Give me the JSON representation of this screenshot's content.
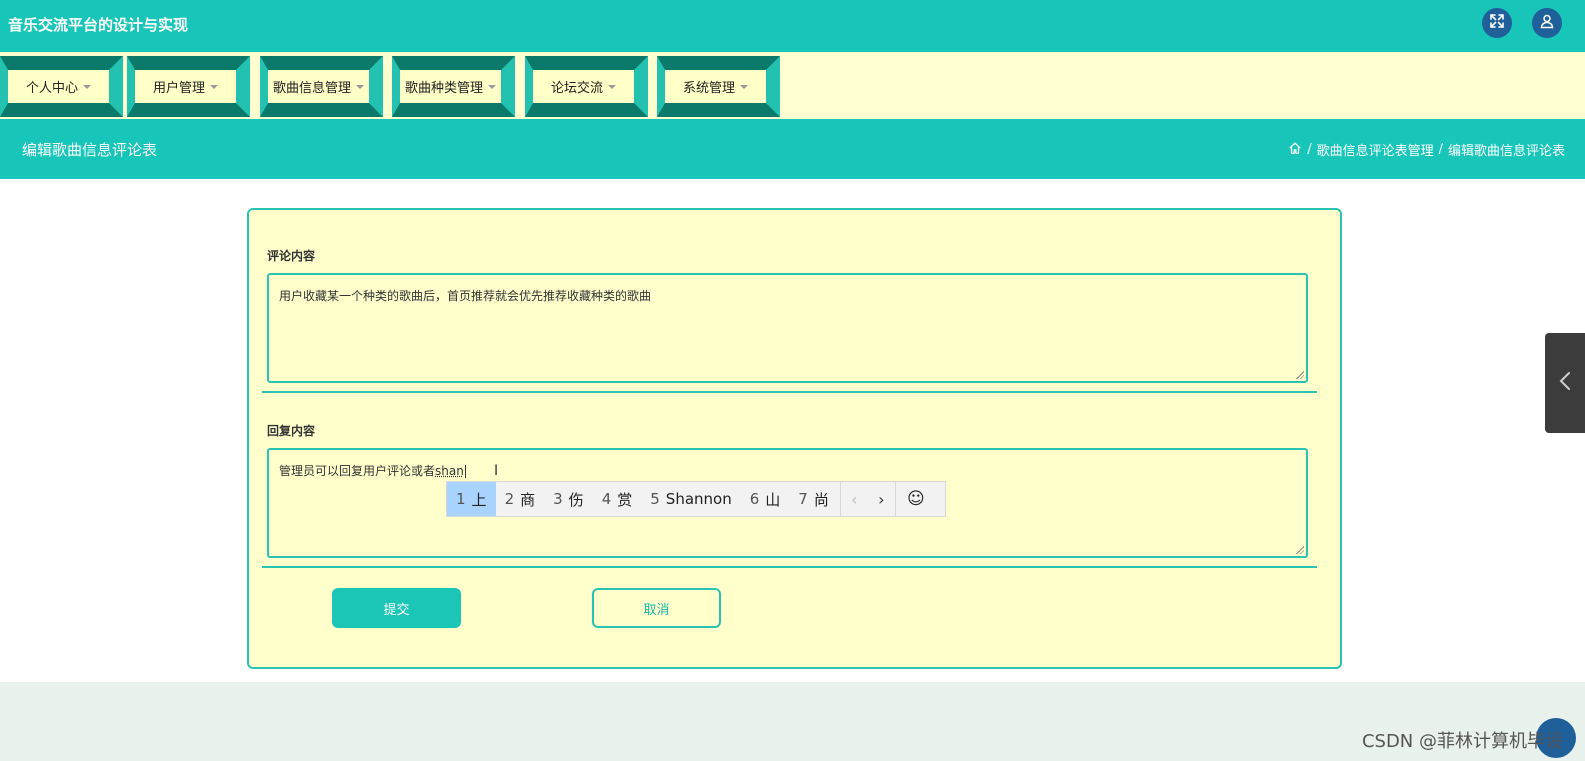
{
  "header": {
    "app_title": "音乐交流平台的设计与实现",
    "icons": [
      "fullscreen-icon",
      "user-icon"
    ]
  },
  "nav": {
    "items": [
      {
        "label": "个人中心"
      },
      {
        "label": "用户管理"
      },
      {
        "label": "歌曲信息管理"
      },
      {
        "label": "歌曲种类管理"
      },
      {
        "label": "论坛交流"
      },
      {
        "label": "系统管理"
      }
    ]
  },
  "titlebar": {
    "page_title": "编辑歌曲信息评论表",
    "breadcrumb": [
      "歌曲信息评论表管理",
      "编辑歌曲信息评论表"
    ],
    "separator": "/"
  },
  "form": {
    "comment_label": "评论内容",
    "comment_value": "用户收藏某一个种类的歌曲后，首页推荐就会优先推荐收藏种类的歌曲",
    "reply_label": "回复内容",
    "reply_committed": "管理员可以回复用户评论或者",
    "reply_composing": "shan",
    "submit_label": "提交",
    "cancel_label": "取消"
  },
  "ime": {
    "candidates": [
      {
        "num": "1",
        "text": "上"
      },
      {
        "num": "2",
        "text": "商"
      },
      {
        "num": "3",
        "text": "伤"
      },
      {
        "num": "4",
        "text": "赏"
      },
      {
        "num": "5",
        "text": "Shannon"
      },
      {
        "num": "6",
        "text": "山"
      },
      {
        "num": "7",
        "text": "尚"
      }
    ],
    "selected_index": 0,
    "prev": "‹",
    "next": "›",
    "emoji": "☺"
  },
  "watermark": "CSDN @菲林计算机毕设",
  "colors": {
    "accent": "#17c6b8",
    "nav_bg": "#ffffd0",
    "form_bg": "#ffffcc",
    "icon_circle": "#1f5f9a",
    "ime_selected": "#a9d3ff"
  }
}
